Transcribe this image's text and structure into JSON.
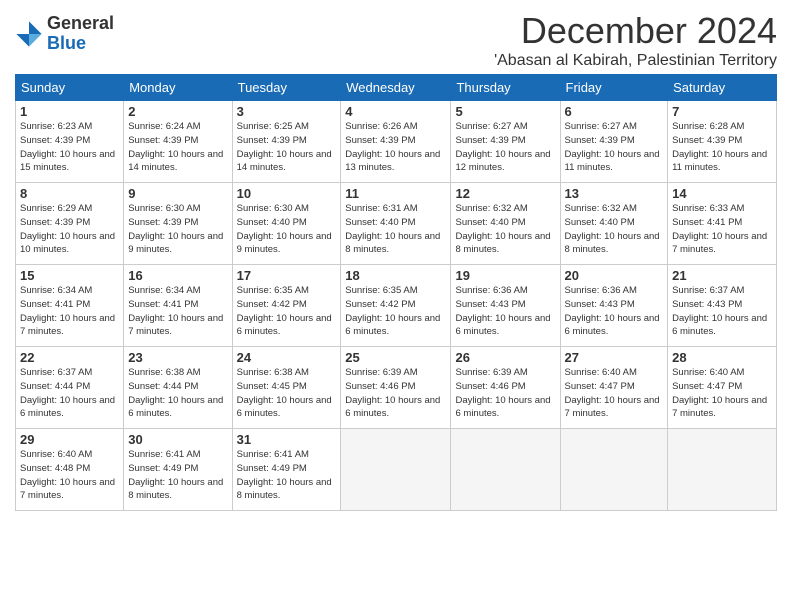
{
  "logo": {
    "general": "General",
    "blue": "Blue"
  },
  "title": "December 2024",
  "location": "'Abasan al Kabirah, Palestinian Territory",
  "days_of_week": [
    "Sunday",
    "Monday",
    "Tuesday",
    "Wednesday",
    "Thursday",
    "Friday",
    "Saturday"
  ],
  "weeks": [
    [
      {
        "day": "1",
        "sunrise": "6:23 AM",
        "sunset": "4:39 PM",
        "daylight": "10 hours and 15 minutes."
      },
      {
        "day": "2",
        "sunrise": "6:24 AM",
        "sunset": "4:39 PM",
        "daylight": "10 hours and 14 minutes."
      },
      {
        "day": "3",
        "sunrise": "6:25 AM",
        "sunset": "4:39 PM",
        "daylight": "10 hours and 14 minutes."
      },
      {
        "day": "4",
        "sunrise": "6:26 AM",
        "sunset": "4:39 PM",
        "daylight": "10 hours and 13 minutes."
      },
      {
        "day": "5",
        "sunrise": "6:27 AM",
        "sunset": "4:39 PM",
        "daylight": "10 hours and 12 minutes."
      },
      {
        "day": "6",
        "sunrise": "6:27 AM",
        "sunset": "4:39 PM",
        "daylight": "10 hours and 11 minutes."
      },
      {
        "day": "7",
        "sunrise": "6:28 AM",
        "sunset": "4:39 PM",
        "daylight": "10 hours and 11 minutes."
      }
    ],
    [
      {
        "day": "8",
        "sunrise": "6:29 AM",
        "sunset": "4:39 PM",
        "daylight": "10 hours and 10 minutes."
      },
      {
        "day": "9",
        "sunrise": "6:30 AM",
        "sunset": "4:39 PM",
        "daylight": "10 hours and 9 minutes."
      },
      {
        "day": "10",
        "sunrise": "6:30 AM",
        "sunset": "4:40 PM",
        "daylight": "10 hours and 9 minutes."
      },
      {
        "day": "11",
        "sunrise": "6:31 AM",
        "sunset": "4:40 PM",
        "daylight": "10 hours and 8 minutes."
      },
      {
        "day": "12",
        "sunrise": "6:32 AM",
        "sunset": "4:40 PM",
        "daylight": "10 hours and 8 minutes."
      },
      {
        "day": "13",
        "sunrise": "6:32 AM",
        "sunset": "4:40 PM",
        "daylight": "10 hours and 8 minutes."
      },
      {
        "day": "14",
        "sunrise": "6:33 AM",
        "sunset": "4:41 PM",
        "daylight": "10 hours and 7 minutes."
      }
    ],
    [
      {
        "day": "15",
        "sunrise": "6:34 AM",
        "sunset": "4:41 PM",
        "daylight": "10 hours and 7 minutes."
      },
      {
        "day": "16",
        "sunrise": "6:34 AM",
        "sunset": "4:41 PM",
        "daylight": "10 hours and 7 minutes."
      },
      {
        "day": "17",
        "sunrise": "6:35 AM",
        "sunset": "4:42 PM",
        "daylight": "10 hours and 6 minutes."
      },
      {
        "day": "18",
        "sunrise": "6:35 AM",
        "sunset": "4:42 PM",
        "daylight": "10 hours and 6 minutes."
      },
      {
        "day": "19",
        "sunrise": "6:36 AM",
        "sunset": "4:43 PM",
        "daylight": "10 hours and 6 minutes."
      },
      {
        "day": "20",
        "sunrise": "6:36 AM",
        "sunset": "4:43 PM",
        "daylight": "10 hours and 6 minutes."
      },
      {
        "day": "21",
        "sunrise": "6:37 AM",
        "sunset": "4:43 PM",
        "daylight": "10 hours and 6 minutes."
      }
    ],
    [
      {
        "day": "22",
        "sunrise": "6:37 AM",
        "sunset": "4:44 PM",
        "daylight": "10 hours and 6 minutes."
      },
      {
        "day": "23",
        "sunrise": "6:38 AM",
        "sunset": "4:44 PM",
        "daylight": "10 hours and 6 minutes."
      },
      {
        "day": "24",
        "sunrise": "6:38 AM",
        "sunset": "4:45 PM",
        "daylight": "10 hours and 6 minutes."
      },
      {
        "day": "25",
        "sunrise": "6:39 AM",
        "sunset": "4:46 PM",
        "daylight": "10 hours and 6 minutes."
      },
      {
        "day": "26",
        "sunrise": "6:39 AM",
        "sunset": "4:46 PM",
        "daylight": "10 hours and 6 minutes."
      },
      {
        "day": "27",
        "sunrise": "6:40 AM",
        "sunset": "4:47 PM",
        "daylight": "10 hours and 7 minutes."
      },
      {
        "day": "28",
        "sunrise": "6:40 AM",
        "sunset": "4:47 PM",
        "daylight": "10 hours and 7 minutes."
      }
    ],
    [
      {
        "day": "29",
        "sunrise": "6:40 AM",
        "sunset": "4:48 PM",
        "daylight": "10 hours and 7 minutes."
      },
      {
        "day": "30",
        "sunrise": "6:41 AM",
        "sunset": "4:49 PM",
        "daylight": "10 hours and 8 minutes."
      },
      {
        "day": "31",
        "sunrise": "6:41 AM",
        "sunset": "4:49 PM",
        "daylight": "10 hours and 8 minutes."
      },
      null,
      null,
      null,
      null
    ]
  ]
}
